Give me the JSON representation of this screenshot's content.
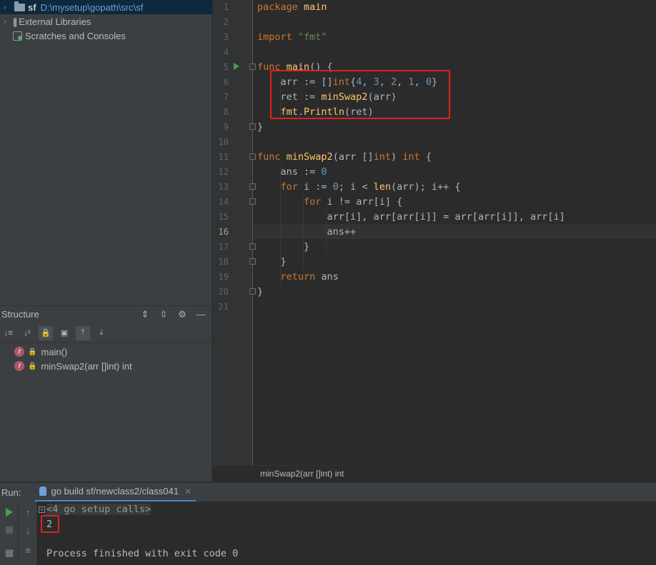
{
  "project": {
    "root_name": "sf",
    "root_path": "D:\\mysetup\\gopath\\src\\sf",
    "external_libraries": "External Libraries",
    "scratches": "Scratches and Consoles"
  },
  "structure": {
    "title": "Structure",
    "items": [
      {
        "badge": "f",
        "label": "main()"
      },
      {
        "badge": "f",
        "label": "minSwap2(arr []int) int"
      }
    ]
  },
  "editor": {
    "line_numbers": [
      "1",
      "2",
      "3",
      "4",
      "5",
      "6",
      "7",
      "8",
      "9",
      "10",
      "11",
      "12",
      "13",
      "14",
      "15",
      "16",
      "17",
      "18",
      "19",
      "20",
      "21"
    ],
    "current_line": "16",
    "breadcrumb": "minSwap2(arr []int) int"
  },
  "run": {
    "label": "Run:",
    "tab_title": "go build sf/newclass2/class041",
    "setup_calls": "<4 go setup calls>",
    "output": "2",
    "finished": "Process finished with exit code 0"
  },
  "colors": {
    "keyword": "#cc7832",
    "function": "#ffc66d",
    "number": "#6897bb",
    "string": "#6a8759",
    "highlight_box": "#e0201c"
  }
}
